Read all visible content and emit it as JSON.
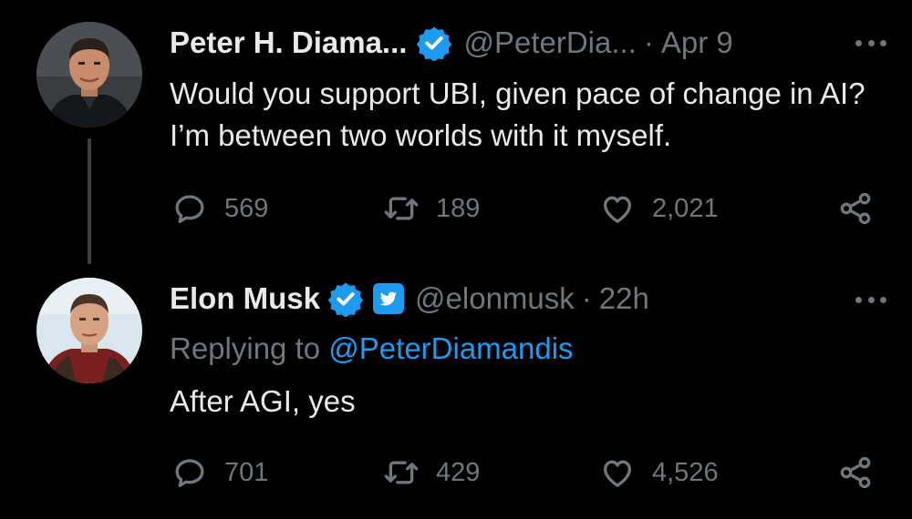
{
  "tweets": [
    {
      "author_name": "Peter H. Diama...",
      "handle": "@PeterDia...",
      "separator": "·",
      "time": "Apr 9",
      "text": "Would you support UBI, given pace of change in AI? I’m between two worlds with it myself.",
      "replies": "569",
      "retweets": "189",
      "likes": "2,021"
    },
    {
      "author_name": "Elon Musk",
      "handle": "@elonmusk",
      "separator": "·",
      "time": "22h",
      "replying_label": "Replying to",
      "replying_to": "@PeterDiamandis",
      "text": "After AGI, yes",
      "replies": "701",
      "retweets": "429",
      "likes": "4,526"
    }
  ],
  "colors": {
    "background": "#000000",
    "text_primary": "#e7e9ea",
    "text_secondary": "#71767b",
    "accent": "#1d9bf0",
    "thread_line": "#3e4144"
  },
  "icons": [
    "verified-badge-icon",
    "twitter-bird-icon",
    "more-icon",
    "reply-icon",
    "retweet-icon",
    "like-icon",
    "share-icon"
  ]
}
